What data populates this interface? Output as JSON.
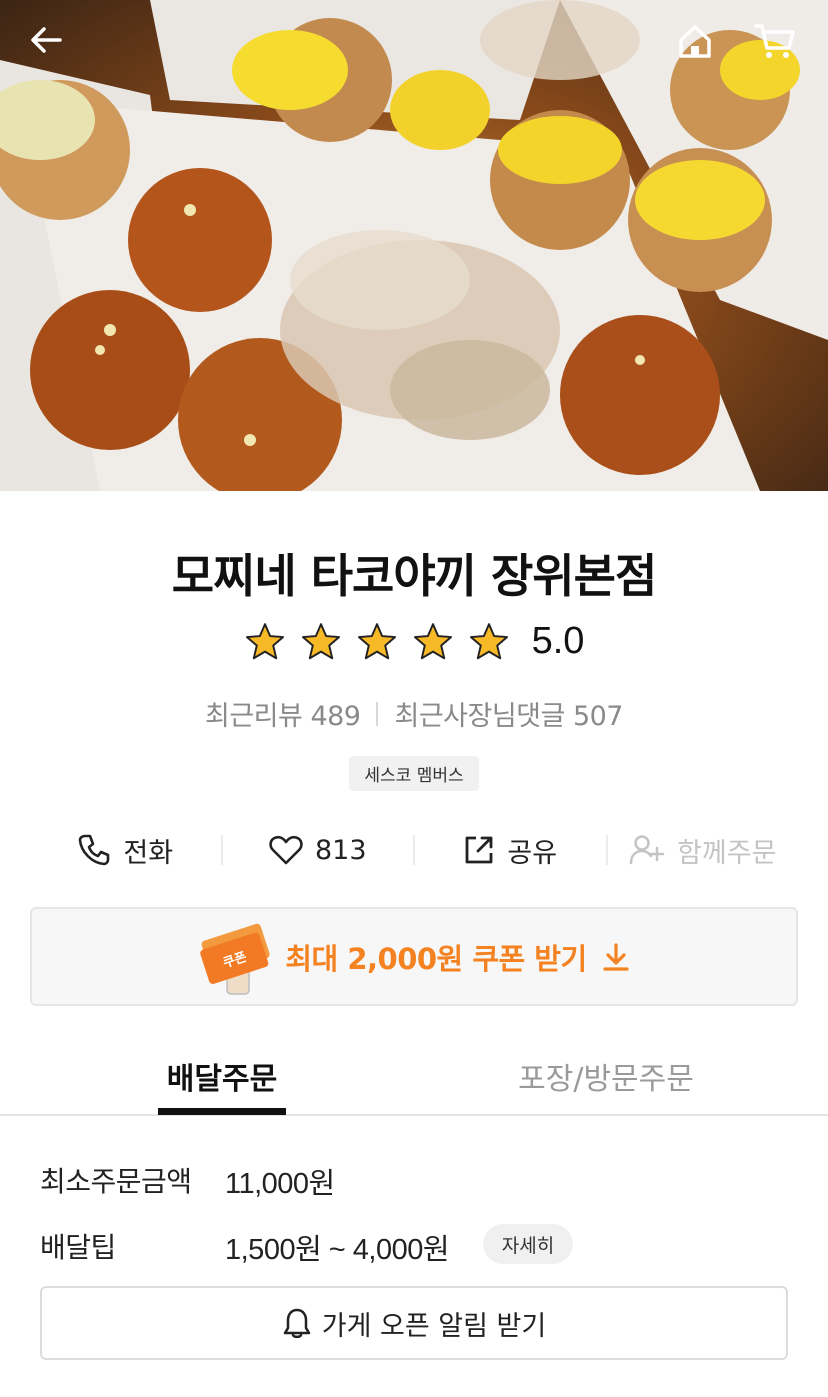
{
  "store": {
    "name": "모찌네 타코야끼 장위본점",
    "rating": "5.0",
    "star_count": 5,
    "recent_reviews_label": "최근리뷰 489",
    "recent_owner_replies_label": "최근사장님댓글 507",
    "member_badge": "세스코 멤버스"
  },
  "actions": {
    "call": "전화",
    "like_count": "813",
    "share": "공유",
    "group_order": "함께주문"
  },
  "coupon": {
    "label": "최대 2,000원 쿠폰 받기",
    "ticket_text": "쿠폰"
  },
  "tabs": {
    "delivery": "배달주문",
    "pickup": "포장/방문주문"
  },
  "order_info": {
    "min_order_label": "최소주문금액",
    "min_order_value": "11,000원",
    "delivery_tip_label": "배달팁",
    "delivery_tip_value": "1,500원 ~ 4,000원",
    "detail_button": "자세히"
  },
  "notify_button": "가게 오픈 알림 받기",
  "colors": {
    "accent_orange": "#f48220",
    "star_yellow": "#f7b928",
    "disabled_gray": "#c4c4c4"
  },
  "icons": {
    "back": "arrow-left-icon",
    "home": "home-icon",
    "cart": "cart-icon",
    "call": "phone-icon",
    "like": "heart-icon",
    "share": "share-icon",
    "group_order": "add-user-icon",
    "coupon_download": "download-icon",
    "notify": "bell-icon"
  }
}
